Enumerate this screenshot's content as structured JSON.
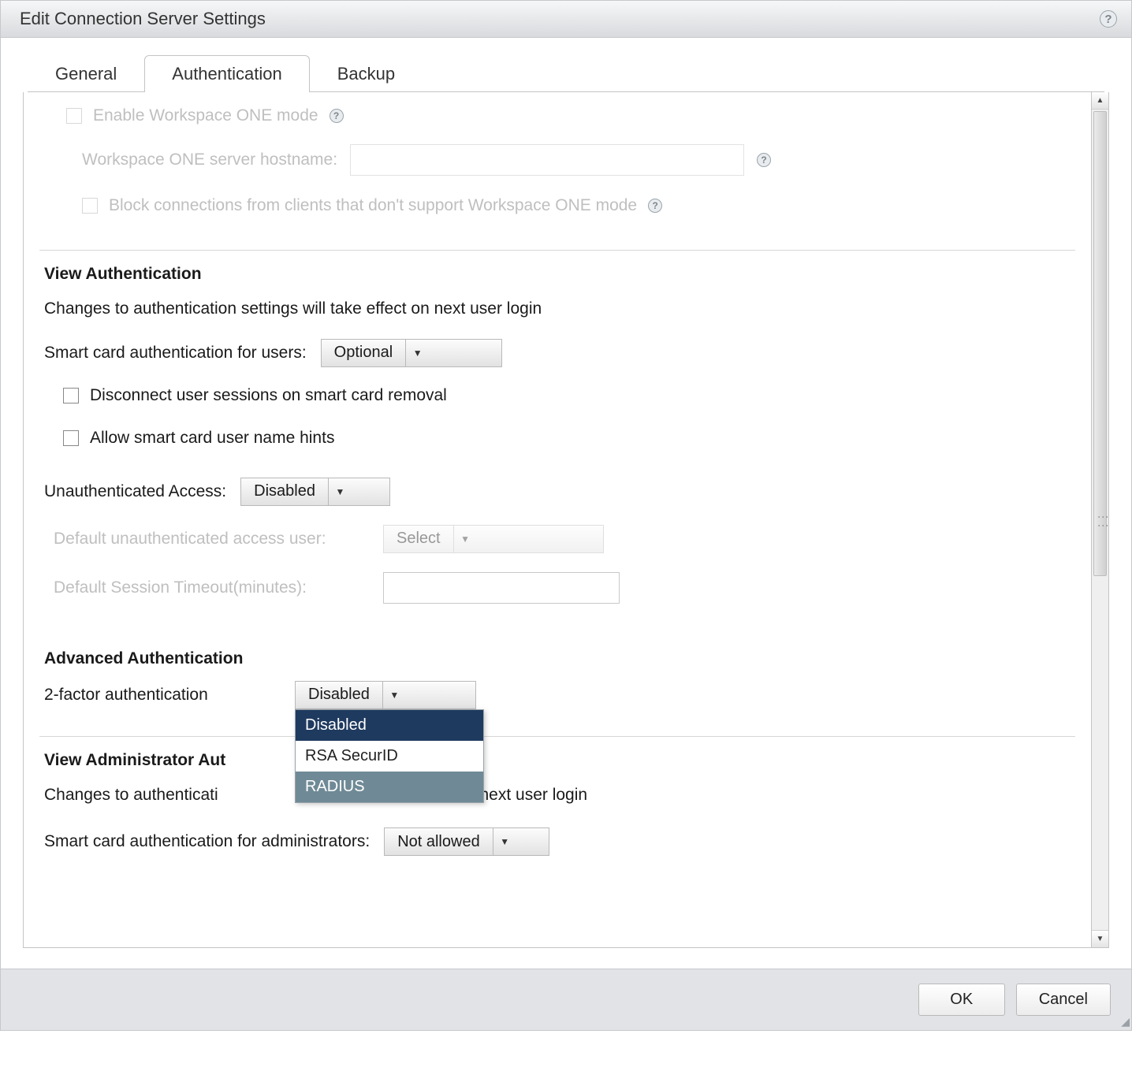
{
  "dialog": {
    "title": "Edit Connection Server Settings"
  },
  "tabs": {
    "general": "General",
    "authentication": "Authentication",
    "backup": "Backup"
  },
  "workspace_one": {
    "enable_label": "Enable Workspace ONE mode",
    "hostname_label": "Workspace ONE server hostname:",
    "hostname_value": "",
    "block_label": "Block connections from clients that don't support Workspace ONE mode"
  },
  "view_auth": {
    "heading": "View Authentication",
    "hint": "Changes to authentication settings will take effect on next user login",
    "smartcard_label": "Smart card authentication for users:",
    "smartcard_value": "Optional",
    "disconnect_label": "Disconnect user sessions on smart card removal",
    "hints_label": "Allow smart card user name hints",
    "unauth_label": "Unauthenticated Access:",
    "unauth_value": "Disabled",
    "default_user_label": "Default unauthenticated access user:",
    "default_user_value": "Select",
    "timeout_label": "Default Session Timeout(minutes):",
    "timeout_value": ""
  },
  "advanced": {
    "heading": "Advanced Authentication",
    "twofa_label": "2-factor authentication",
    "twofa_value": "Disabled",
    "twofa_options": {
      "o0": "Disabled",
      "o1": "RSA SecurID",
      "o2": "RADIUS"
    }
  },
  "admin_auth": {
    "heading_partial": "View Administrator Aut",
    "hint_before": "Changes to authenticati",
    "hint_after": " effect on next user login",
    "smartcard_admin_label": "Smart card authentication for administrators:",
    "smartcard_admin_value": "Not allowed"
  },
  "footer": {
    "ok": "OK",
    "cancel": "Cancel"
  },
  "glyphs": {
    "help": "?",
    "caret_down": "▼",
    "caret_up": "▲"
  }
}
